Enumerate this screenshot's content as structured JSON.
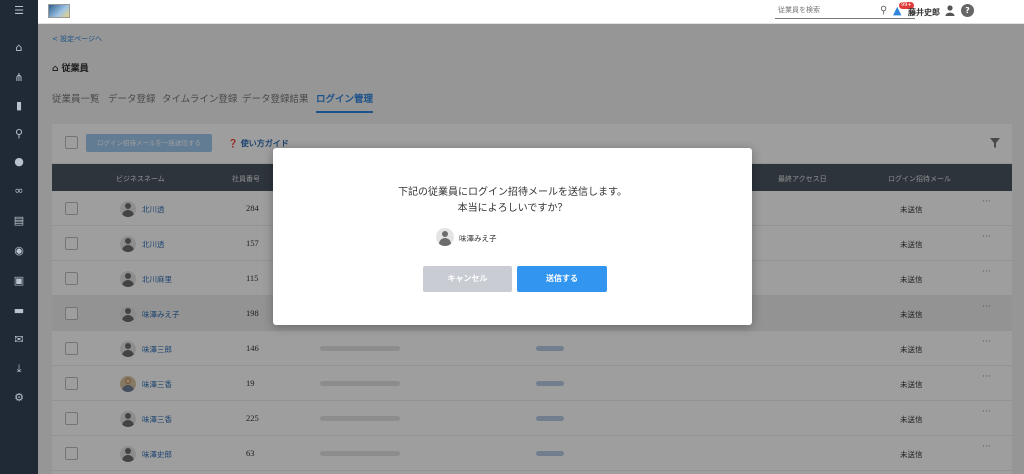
{
  "header": {
    "search_placeholder": "従業員を検索",
    "notification_badge": "99+",
    "user_name": "藤井史郎",
    "help_label": "?"
  },
  "page": {
    "back_link": "< 設定ページへ",
    "title": "従業員"
  },
  "tabs": [
    {
      "label": "従業員一覧"
    },
    {
      "label": "データ登録"
    },
    {
      "label": "タイムライン登録"
    },
    {
      "label": "データ登録結果"
    },
    {
      "label": "ログイン管理",
      "active": true
    }
  ],
  "toolbar": {
    "bulk_button": "ログイン招待メールを一括送信する",
    "guide_link": "使い方ガイド"
  },
  "table": {
    "columns": [
      "ビジネスネーム",
      "社員番号",
      "最終アクセス日",
      "ログイン招待メール"
    ],
    "rows": [
      {
        "name": "北川透",
        "emp_no": "284",
        "status": "未送信"
      },
      {
        "name": "北川透",
        "emp_no": "157",
        "status": "未送信"
      },
      {
        "name": "北川麻里",
        "emp_no": "115",
        "status": "未送信"
      },
      {
        "name": "味澤みえ子",
        "emp_no": "198",
        "status": "未送信",
        "highlight": true
      },
      {
        "name": "味澤三郎",
        "emp_no": "146",
        "status": "未送信"
      },
      {
        "name": "味澤三香",
        "emp_no": "19",
        "status": "未送信",
        "photo": true
      },
      {
        "name": "味澤三香",
        "emp_no": "225",
        "status": "未送信"
      },
      {
        "name": "味澤史郎",
        "emp_no": "63",
        "status": "未送信"
      }
    ],
    "more_label": "···"
  },
  "modal": {
    "message_line1": "下記の従業員にログイン招待メールを送信します。",
    "message_line2": "本当によろしいですか？",
    "employee_name": "味澤みえ子",
    "cancel_label": "キャンセル",
    "send_label": "送信する"
  },
  "colors": {
    "accent": "#2e86de",
    "send_button": "#3295f0",
    "sidebar": "#1f2a36",
    "table_header": "#4a5562"
  }
}
